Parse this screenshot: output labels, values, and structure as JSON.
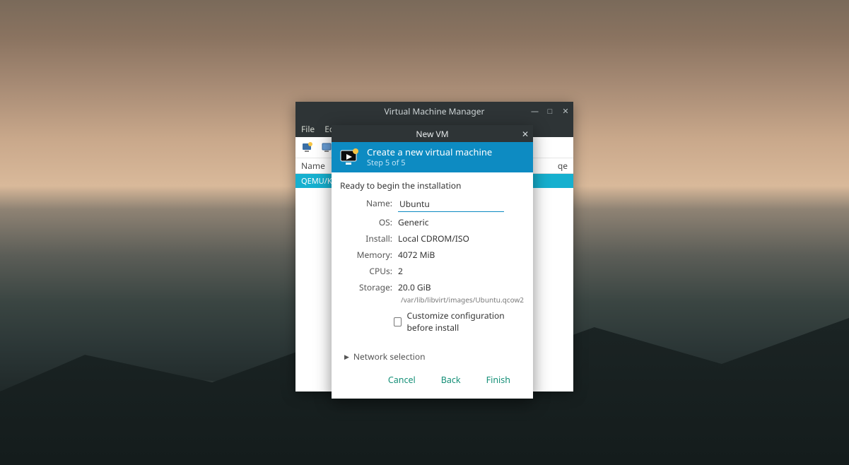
{
  "vmm": {
    "title": "Virtual Machine Manager",
    "menu": {
      "file": "File",
      "edit": "Edit"
    },
    "columns": {
      "name": "Name",
      "usage_fragment": "qe"
    },
    "connection_row": "QEMU/KV"
  },
  "dialog": {
    "title": "New VM",
    "header_title": "Create a new virtual machine",
    "header_step": "Step 5 of 5",
    "ready_text": "Ready to begin the installation",
    "labels": {
      "name": "Name:",
      "os": "OS:",
      "install": "Install:",
      "memory": "Memory:",
      "cpus": "CPUs:",
      "storage": "Storage:"
    },
    "values": {
      "name": "Ubuntu",
      "os": "Generic",
      "install": "Local CDROM/ISO",
      "memory": "4072 MiB",
      "cpus": "2",
      "storage_size": "20.0 GiB",
      "storage_path": "/var/lib/libvirt/images/Ubuntu.qcow2"
    },
    "customize_label": "Customize configuration before install",
    "network_selection": "Network selection",
    "actions": {
      "cancel": "Cancel",
      "back": "Back",
      "finish": "Finish"
    }
  },
  "icons": {
    "minimize": "—",
    "maximize": "□",
    "close": "✕"
  }
}
